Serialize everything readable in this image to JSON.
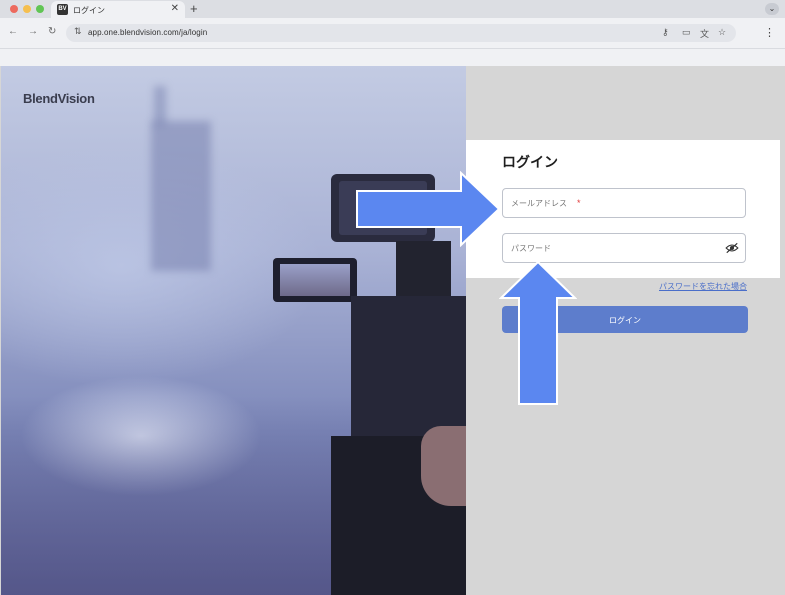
{
  "browser": {
    "tab_title": "ログイン",
    "favicon_text": "BV",
    "url": "app.one.blendvision.com/ja/login",
    "icons": [
      "back-icon",
      "forward-icon",
      "reload-icon",
      "site-settings-icon",
      "key-icon",
      "cast-icon",
      "translate-icon",
      "star-icon",
      "menu-icon"
    ]
  },
  "page": {
    "brand": "BlendVision",
    "login_title": "ログイン",
    "email_placeholder": "メールアドレス",
    "email_required_mark": "*",
    "password_placeholder": "パスワード",
    "forgot_password": "パスワードを忘れた場合",
    "login_button": "ログイン"
  },
  "colors": {
    "accent": "#5d7dcc",
    "arrow": "#5b87f0",
    "required": "#e03a3a",
    "link": "#4a6ec9"
  }
}
